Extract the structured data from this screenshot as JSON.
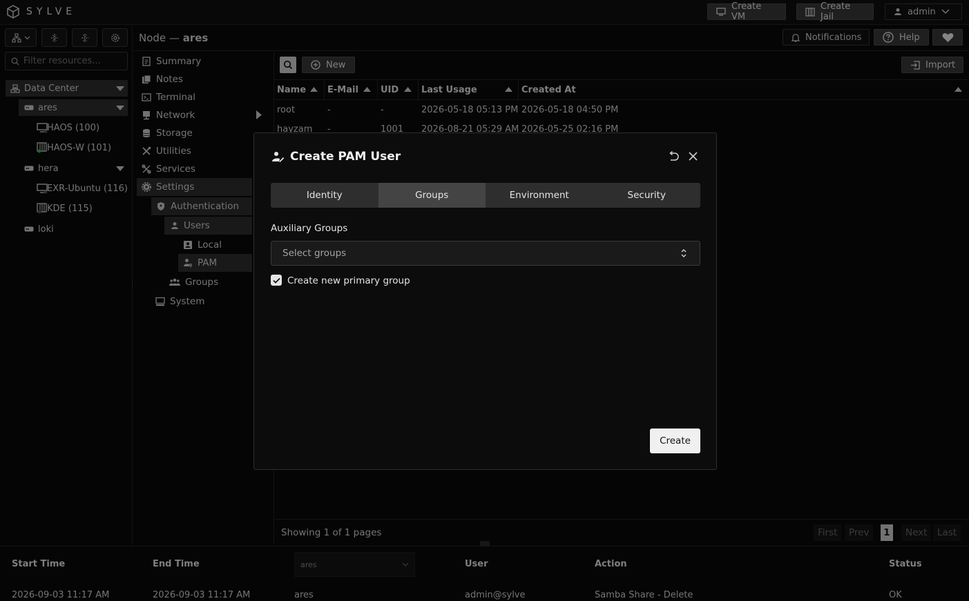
{
  "app": {
    "logo_text": "SYLVE"
  },
  "topbar": {
    "create_vm": "Create VM",
    "create_jail": "Create Jail",
    "user": "admin"
  },
  "sidebar": {
    "filter_placeholder": "Filter resources...",
    "tree": {
      "datacenter": "Data Center",
      "nodes": [
        {
          "name": "ares",
          "children": [
            {
              "name": "HAOS (100)"
            },
            {
              "name": "HAOS-W (101)"
            }
          ]
        },
        {
          "name": "hera",
          "children": [
            {
              "name": "EXR-Ubuntu (116)"
            },
            {
              "name": "KDE (115)"
            }
          ]
        },
        {
          "name": "loki"
        }
      ]
    }
  },
  "header": {
    "breadcrumb_prefix": "Node — ",
    "breadcrumb_node": "ares",
    "notifications": "Notifications",
    "help": "Help"
  },
  "menu": {
    "summary": "Summary",
    "notes": "Notes",
    "terminal": "Terminal",
    "network": "Network",
    "storage": "Storage",
    "utilities": "Utilities",
    "services": "Services",
    "settings": "Settings",
    "authentication": "Authentication",
    "users": "Users",
    "local": "Local",
    "pam": "PAM",
    "groups": "Groups",
    "system": "System"
  },
  "content": {
    "new_button": "New",
    "import_button": "Import",
    "columns": [
      "Name",
      "E-Mail",
      "UID",
      "Last Usage",
      "Created At"
    ],
    "rows": [
      {
        "name": "root",
        "email": "-",
        "uid": "-",
        "last_usage": "2026-05-18 05:13 PM",
        "created_at": "2026-05-18 04:50 PM"
      },
      {
        "name": "hayzam",
        "email": "-",
        "uid": "1001",
        "last_usage": "2026-08-21 05:29 AM",
        "created_at": "2026-05-25 02:16 PM"
      }
    ],
    "pagination": {
      "showing": "Showing 1 of 1 pages",
      "first": "First",
      "prev": "Prev",
      "current": "1",
      "next": "Next",
      "last": "Last"
    }
  },
  "bottom": {
    "columns": {
      "start": "Start Time",
      "end": "End Time",
      "node_select": "ares",
      "user": "User",
      "action": "Action",
      "status": "Status"
    },
    "rows": [
      {
        "start": "2026-09-03 11:17 AM",
        "end": "2026-09-03 11:17 AM",
        "node": "ares",
        "user": "admin@sylve",
        "action": "Samba Share - Delete",
        "status": "OK"
      }
    ]
  },
  "modal": {
    "title": "Create PAM User",
    "tabs": [
      "Identity",
      "Groups",
      "Environment",
      "Security"
    ],
    "active_tab": "Groups",
    "aux_label": "Auxiliary Groups",
    "select_placeholder": "Select groups",
    "checkbox_label": "Create new primary group",
    "checkbox_checked": true,
    "create_button": "Create"
  }
}
